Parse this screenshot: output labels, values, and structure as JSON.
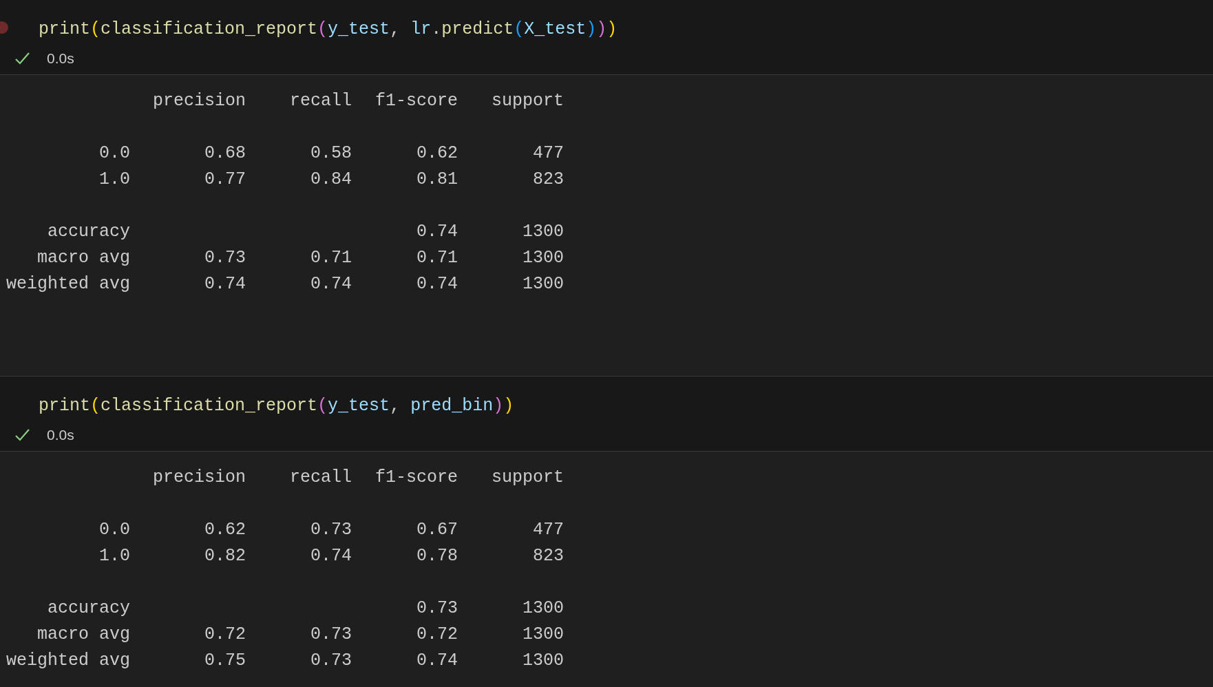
{
  "cells": [
    {
      "dirty": true,
      "code": [
        {
          "text": "print",
          "kind": "function"
        },
        {
          "text": "(",
          "kind": "bracket1"
        },
        {
          "text": "classification_report",
          "kind": "function"
        },
        {
          "text": "(",
          "kind": "bracket2"
        },
        {
          "text": "y_test",
          "kind": "variable"
        },
        {
          "text": ", ",
          "kind": "plain"
        },
        {
          "text": "lr",
          "kind": "variable"
        },
        {
          "text": ".",
          "kind": "plain"
        },
        {
          "text": "predict",
          "kind": "function"
        },
        {
          "text": "(",
          "kind": "bracket3"
        },
        {
          "text": "X_test",
          "kind": "variable"
        },
        {
          "text": ")",
          "kind": "bracket3"
        },
        {
          "text": ")",
          "kind": "bracket2"
        },
        {
          "text": ")",
          "kind": "bracket1"
        }
      ],
      "status": {
        "success": true,
        "time": "0.0s"
      },
      "output": {
        "header": [
          "precision",
          "recall",
          "f1-score",
          "support"
        ],
        "classes": [
          {
            "label": "0.0",
            "precision": "0.68",
            "recall": "0.58",
            "f1": "0.62",
            "support": "477"
          },
          {
            "label": "1.0",
            "precision": "0.77",
            "recall": "0.84",
            "f1": "0.81",
            "support": "823"
          }
        ],
        "summary": [
          {
            "label": "accuracy",
            "f1": "0.74",
            "support": "1300"
          },
          {
            "label": "macro avg",
            "precision": "0.73",
            "recall": "0.71",
            "f1": "0.71",
            "support": "1300"
          },
          {
            "label": "weighted avg",
            "precision": "0.74",
            "recall": "0.74",
            "f1": "0.74",
            "support": "1300"
          }
        ]
      }
    },
    {
      "dirty": false,
      "code": [
        {
          "text": "print",
          "kind": "function"
        },
        {
          "text": "(",
          "kind": "bracket1"
        },
        {
          "text": "classification_report",
          "kind": "function"
        },
        {
          "text": "(",
          "kind": "bracket2"
        },
        {
          "text": "y_test",
          "kind": "variable"
        },
        {
          "text": ", ",
          "kind": "plain"
        },
        {
          "text": "pred_bin",
          "kind": "variable"
        },
        {
          "text": ")",
          "kind": "bracket2"
        },
        {
          "text": ")",
          "kind": "bracket1"
        }
      ],
      "status": {
        "success": true,
        "time": "0.0s"
      },
      "output": {
        "header": [
          "precision",
          "recall",
          "f1-score",
          "support"
        ],
        "classes": [
          {
            "label": "0.0",
            "precision": "0.62",
            "recall": "0.73",
            "f1": "0.67",
            "support": "477"
          },
          {
            "label": "1.0",
            "precision": "0.82",
            "recall": "0.74",
            "f1": "0.78",
            "support": "823"
          }
        ],
        "summary": [
          {
            "label": "accuracy",
            "f1": "0.73",
            "support": "1300"
          },
          {
            "label": "macro avg",
            "precision": "0.72",
            "recall": "0.73",
            "f1": "0.72",
            "support": "1300"
          },
          {
            "label": "weighted avg",
            "precision": "0.75",
            "recall": "0.73",
            "f1": "0.74",
            "support": "1300"
          }
        ]
      }
    }
  ]
}
